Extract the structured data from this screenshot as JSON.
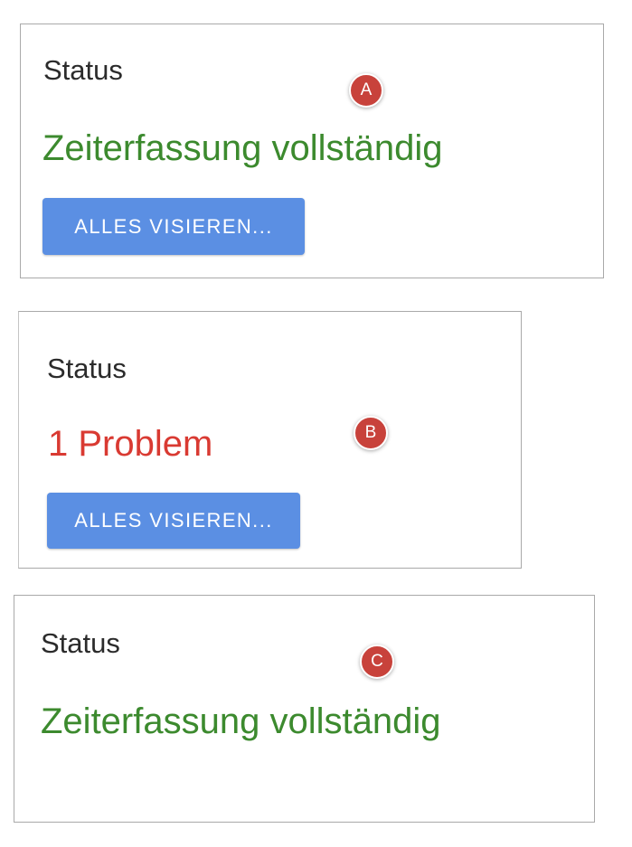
{
  "panels": {
    "a": {
      "label": "Status",
      "status": "Zeiterfassung vollständig",
      "button": "ALLES VISIEREN...",
      "marker": "A"
    },
    "b": {
      "label": "Status",
      "status": "1 Problem",
      "button": "ALLES VISIEREN...",
      "marker": "B"
    },
    "c": {
      "label": "Status",
      "status": "Zeiterfassung vollständig",
      "marker": "C"
    }
  },
  "colors": {
    "ok": "#3c8a2e",
    "error": "#d93a32",
    "button": "#5b8fe3",
    "marker": "#c8423b"
  }
}
